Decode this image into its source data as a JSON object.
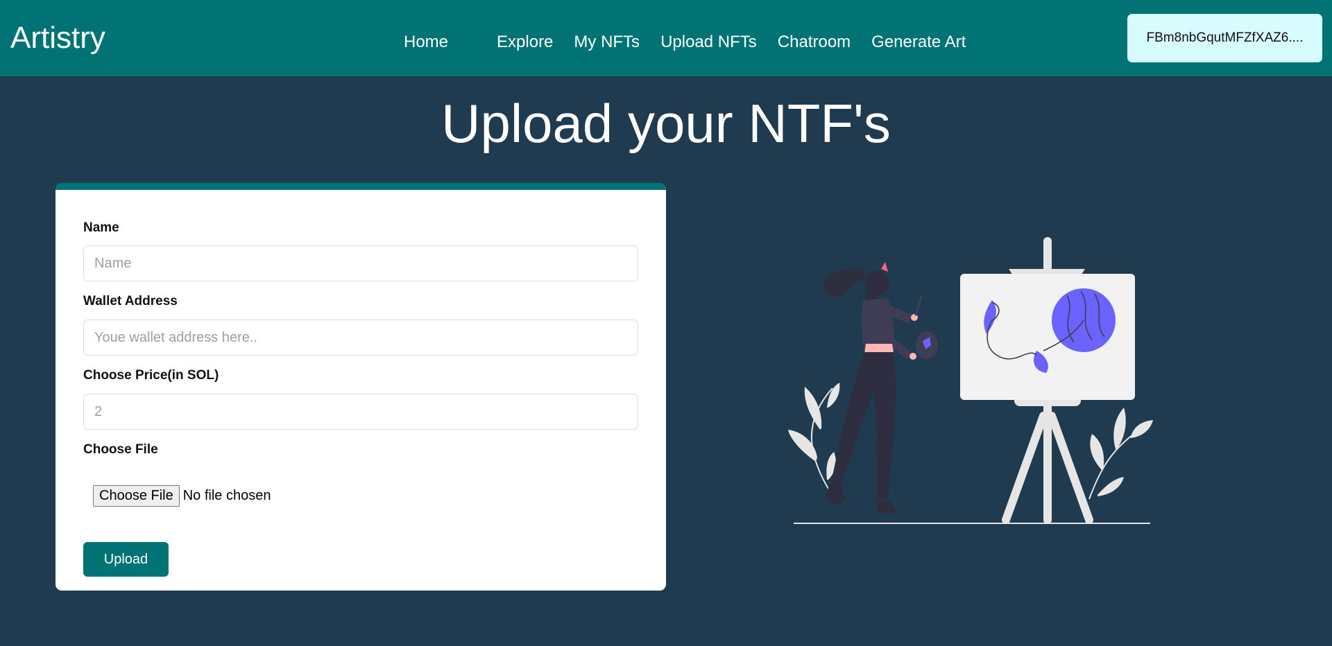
{
  "navbar": {
    "brand": "Artistry",
    "links": [
      "Home",
      "Explore",
      "My NFTs",
      "Upload NFTs",
      "Chatroom",
      "Generate Art"
    ],
    "wallet_label": "FBm8nbGqutMFZfXAZ6...."
  },
  "main": {
    "title": "Upload your NTF's",
    "form": {
      "name_label": "Name",
      "name_placeholder": "Name",
      "wallet_label": "Wallet Address",
      "wallet_placeholder": "Youe wallet address here..",
      "price_label": "Choose Price(in SOL)",
      "price_placeholder": "2",
      "file_label": "Choose File",
      "file_button": "Choose File",
      "file_status": "No file chosen",
      "submit_label": "Upload"
    }
  },
  "colors": {
    "navbar": "#017374",
    "background": "#203a4f",
    "accent": "#6c63ff",
    "wallet_button": "#d6fcfd"
  },
  "icons": [
    "woman-painting-illustration"
  ]
}
